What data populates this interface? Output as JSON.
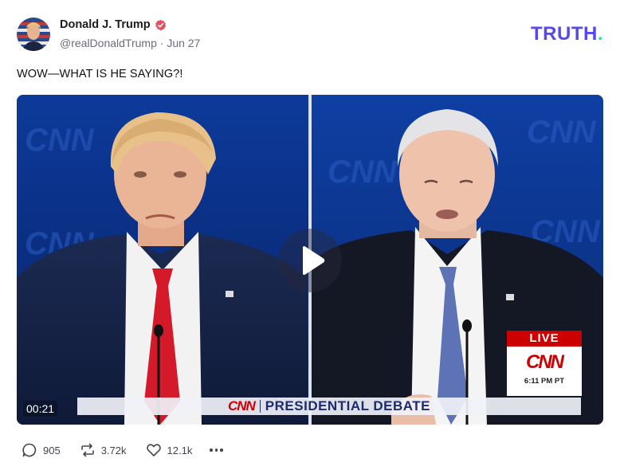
{
  "post": {
    "author_name": "Donald J. Trump",
    "handle": "@realDonaldTrump",
    "separator": "·",
    "date": "Jun 27",
    "text": "WOW—WHAT IS HE SAYING?!"
  },
  "brand": {
    "logo_main": "TRUTH",
    "logo_dot": ".",
    "logo_color": "#5448ee",
    "logo_dot_color": "#21e1c1"
  },
  "media": {
    "duration": "00:21",
    "lower_third_network": "CNN",
    "lower_third_title": "PRESIDENTIAL DEBATE",
    "bug_live": "LIVE",
    "bug_network": "CNN",
    "bug_time": "6:11 PM PT",
    "backdrop_text": "CNN"
  },
  "actions": {
    "replies": "905",
    "retruths": "3.72k",
    "likes": "12.1k"
  },
  "icons": [
    "verified-badge-icon",
    "play-icon",
    "reply-icon",
    "retruth-icon",
    "like-icon",
    "more-icon"
  ],
  "colors": {
    "verified": "#e0525f",
    "network_red": "#cc0000",
    "debate_blue": "#1d2a6b"
  }
}
